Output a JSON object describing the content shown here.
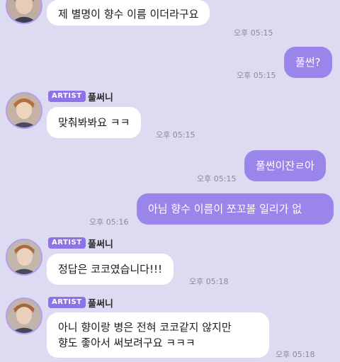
{
  "colors": {
    "background": "#dcdbf1",
    "outgoing_bubble": "#9a85ea",
    "incoming_bubble": "#ffffff",
    "artist_badge": "#8d74e6",
    "avatar_border": "#b49cf0"
  },
  "messages": [
    {
      "id": "m1",
      "direction": "incoming",
      "text": "제 별명이 향수 이름 이더라구요",
      "time": "오후 05:15"
    },
    {
      "id": "m2",
      "direction": "outgoing",
      "text": "풀썬?",
      "time": "오후 05:15"
    },
    {
      "id": "m3",
      "direction": "incoming",
      "badge": "ARTIST",
      "sender": "풀써니",
      "text": "맞춰봐봐요 ㅋㅋ",
      "time": "오후 05:15"
    },
    {
      "id": "m4",
      "direction": "outgoing",
      "text": "풀썬이잔ㄹ아",
      "time": "오후 05:15"
    },
    {
      "id": "m5",
      "direction": "outgoing",
      "text": "아님 향수 이름이 쪼꼬볼 일리가 없",
      "time": "오후 05:16"
    },
    {
      "id": "m6",
      "direction": "incoming",
      "badge": "ARTIST",
      "sender": "풀써니",
      "text": "정답은 코코였습니다!!!",
      "time": "오후 05:18"
    },
    {
      "id": "m7",
      "direction": "incoming",
      "badge": "ARTIST",
      "sender": "풀써니",
      "text_lines": [
        "아니 향이랑 병은 전혀 코코같지 않지만",
        "향도 좋아서 써보려구요 ㅋㅋㅋ"
      ],
      "time": "오후 05:18"
    }
  ]
}
